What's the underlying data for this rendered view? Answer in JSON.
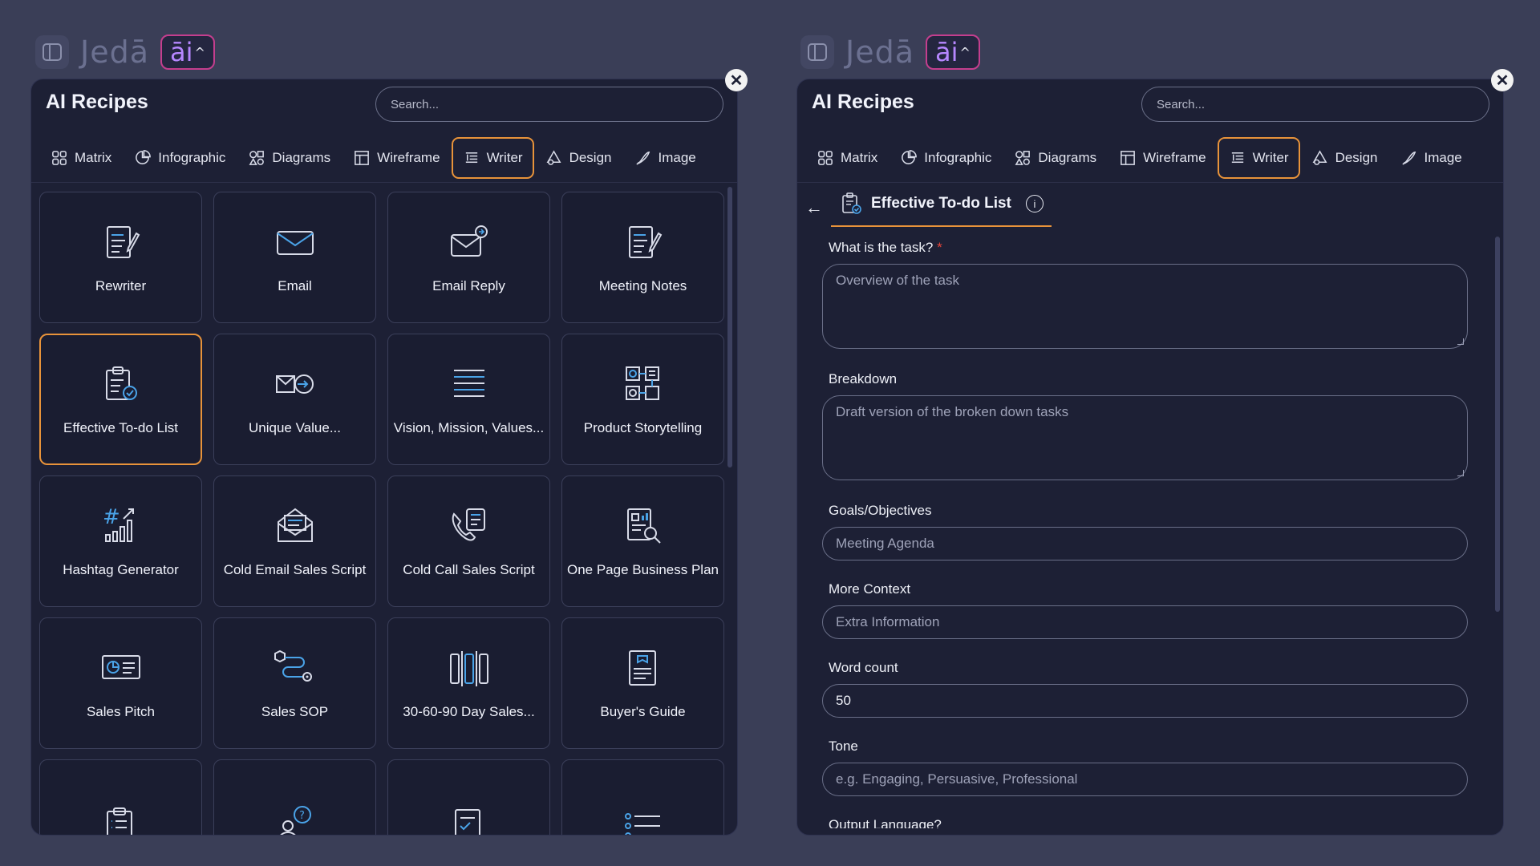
{
  "toolbar": {
    "word": "Jedā",
    "ai_label": "āi",
    "chevron": "^"
  },
  "left": {
    "title": "AI Recipes",
    "search_placeholder": "Search...",
    "tabs": [
      {
        "label": "Matrix",
        "icon": "grid-icon"
      },
      {
        "label": "Infographic",
        "icon": "pie-icon"
      },
      {
        "label": "Diagrams",
        "icon": "shapes-icon"
      },
      {
        "label": "Wireframe",
        "icon": "wireframe-icon"
      },
      {
        "label": "Writer",
        "icon": "writer-icon",
        "active": true
      },
      {
        "label": "Design",
        "icon": "design-icon"
      },
      {
        "label": "Image",
        "icon": "image-icon"
      }
    ],
    "cards": [
      {
        "label": "Rewriter",
        "icon": "document-pen-icon"
      },
      {
        "label": "Email",
        "icon": "envelope-icon"
      },
      {
        "label": "Email Reply",
        "icon": "envelope-reply-icon"
      },
      {
        "label": "Meeting Notes",
        "icon": "document-pen-icon"
      },
      {
        "label": "Effective To-do List",
        "icon": "clipboard-check-icon",
        "active": true
      },
      {
        "label": "Unique Value...",
        "icon": "value-icon"
      },
      {
        "label": "Vision, Mission, Values...",
        "icon": "lines-icon"
      },
      {
        "label": "Product Storytelling",
        "icon": "storyboard-icon"
      },
      {
        "label": "Hashtag Generator",
        "icon": "hashtag-chart-icon"
      },
      {
        "label": "Cold Email Sales Script",
        "icon": "envelope-open-icon"
      },
      {
        "label": "Cold Call Sales Script",
        "icon": "phone-script-icon"
      },
      {
        "label": "One Page Business Plan",
        "icon": "report-search-icon"
      },
      {
        "label": "Sales Pitch",
        "icon": "presentation-icon"
      },
      {
        "label": "Sales SOP",
        "icon": "process-flow-icon"
      },
      {
        "label": "30-60-90 Day Sales...",
        "icon": "columns-icon"
      },
      {
        "label": "Buyer's Guide",
        "icon": "guide-document-icon"
      },
      {
        "label": "",
        "icon": "clipboard-list-icon"
      },
      {
        "label": "",
        "icon": "person-question-icon"
      },
      {
        "label": "",
        "icon": "document-check-icon"
      },
      {
        "label": "",
        "icon": "bullet-list-icon"
      }
    ]
  },
  "right": {
    "title": "AI Recipes",
    "search_placeholder": "Search...",
    "recipe_name": "Effective To-do List",
    "back_arrow": "←",
    "info_glyph": "i",
    "fields": {
      "task_label": "What is the task?",
      "required_mark": "*",
      "task_placeholder": "Overview of the task",
      "breakdown_label": "Breakdown",
      "breakdown_placeholder": "Draft version of the broken down tasks",
      "goals_label": "Goals/Objectives",
      "goals_placeholder": "Meeting Agenda",
      "context_label": "More Context",
      "context_placeholder": "Extra Information",
      "wordcount_label": "Word count",
      "wordcount_value": "50",
      "tone_label": "Tone",
      "tone_placeholder": "e.g. Engaging, Persuasive, Professional",
      "language_label": "Output Language?"
    }
  },
  "close_glyph": "✕",
  "colors": {
    "accent": "#e8933a",
    "ai_border": "#c43e8e",
    "panel": "#1d2035",
    "background": "#3a3e57"
  }
}
